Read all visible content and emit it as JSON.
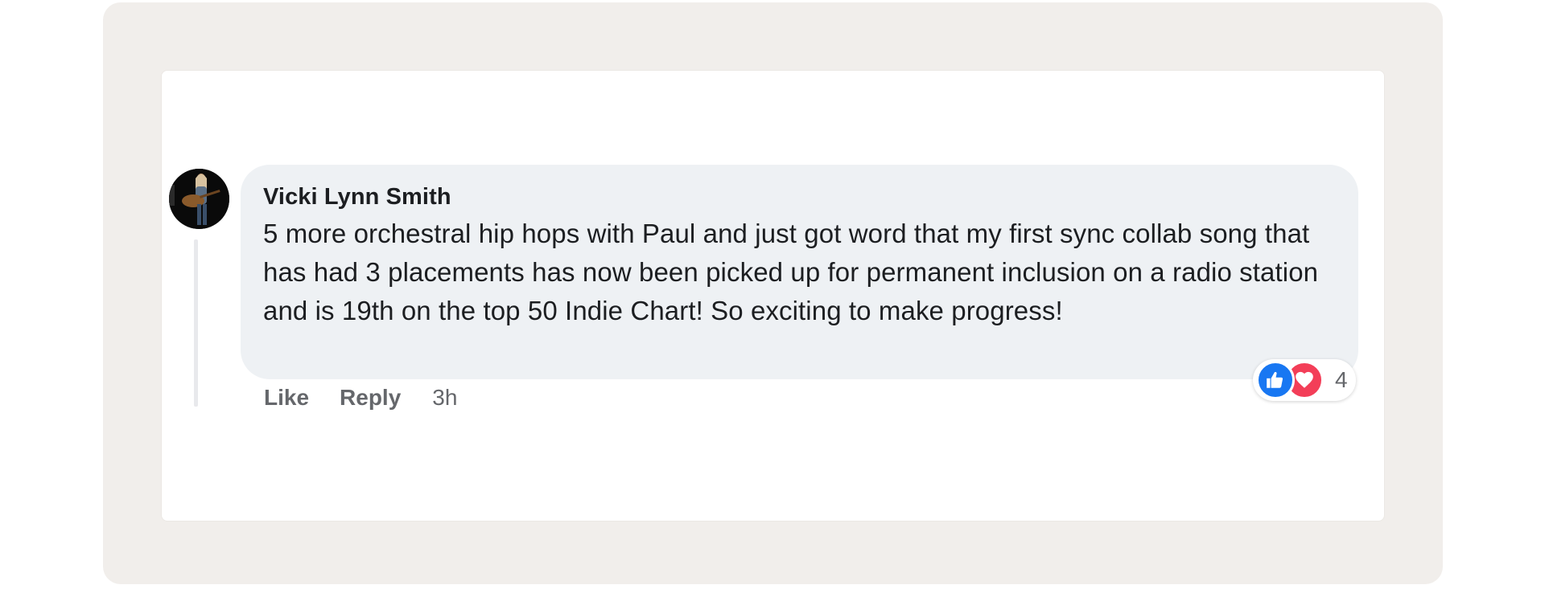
{
  "comment": {
    "author": "Vicki Lynn Smith",
    "text": "5 more orchestral hip hops with Paul and just got word that my first sync collab song that has had 3 placements has now been picked up for permanent inclusion on a radio station and is 19th on the top 50 Indie Chart! So exciting to make progress!",
    "actions": {
      "like_label": "Like",
      "reply_label": "Reply",
      "time_ago": "3h"
    },
    "reactions": {
      "icons": [
        "thumbs-up-icon",
        "heart-icon"
      ],
      "count": "4"
    }
  },
  "colors": {
    "frame_bg": "#f1eeeb",
    "bubble_bg": "#eef1f4",
    "text": "#1c1e21",
    "muted": "#65676b",
    "like_blue": "#1877f2",
    "love_red": "#f33e58"
  }
}
